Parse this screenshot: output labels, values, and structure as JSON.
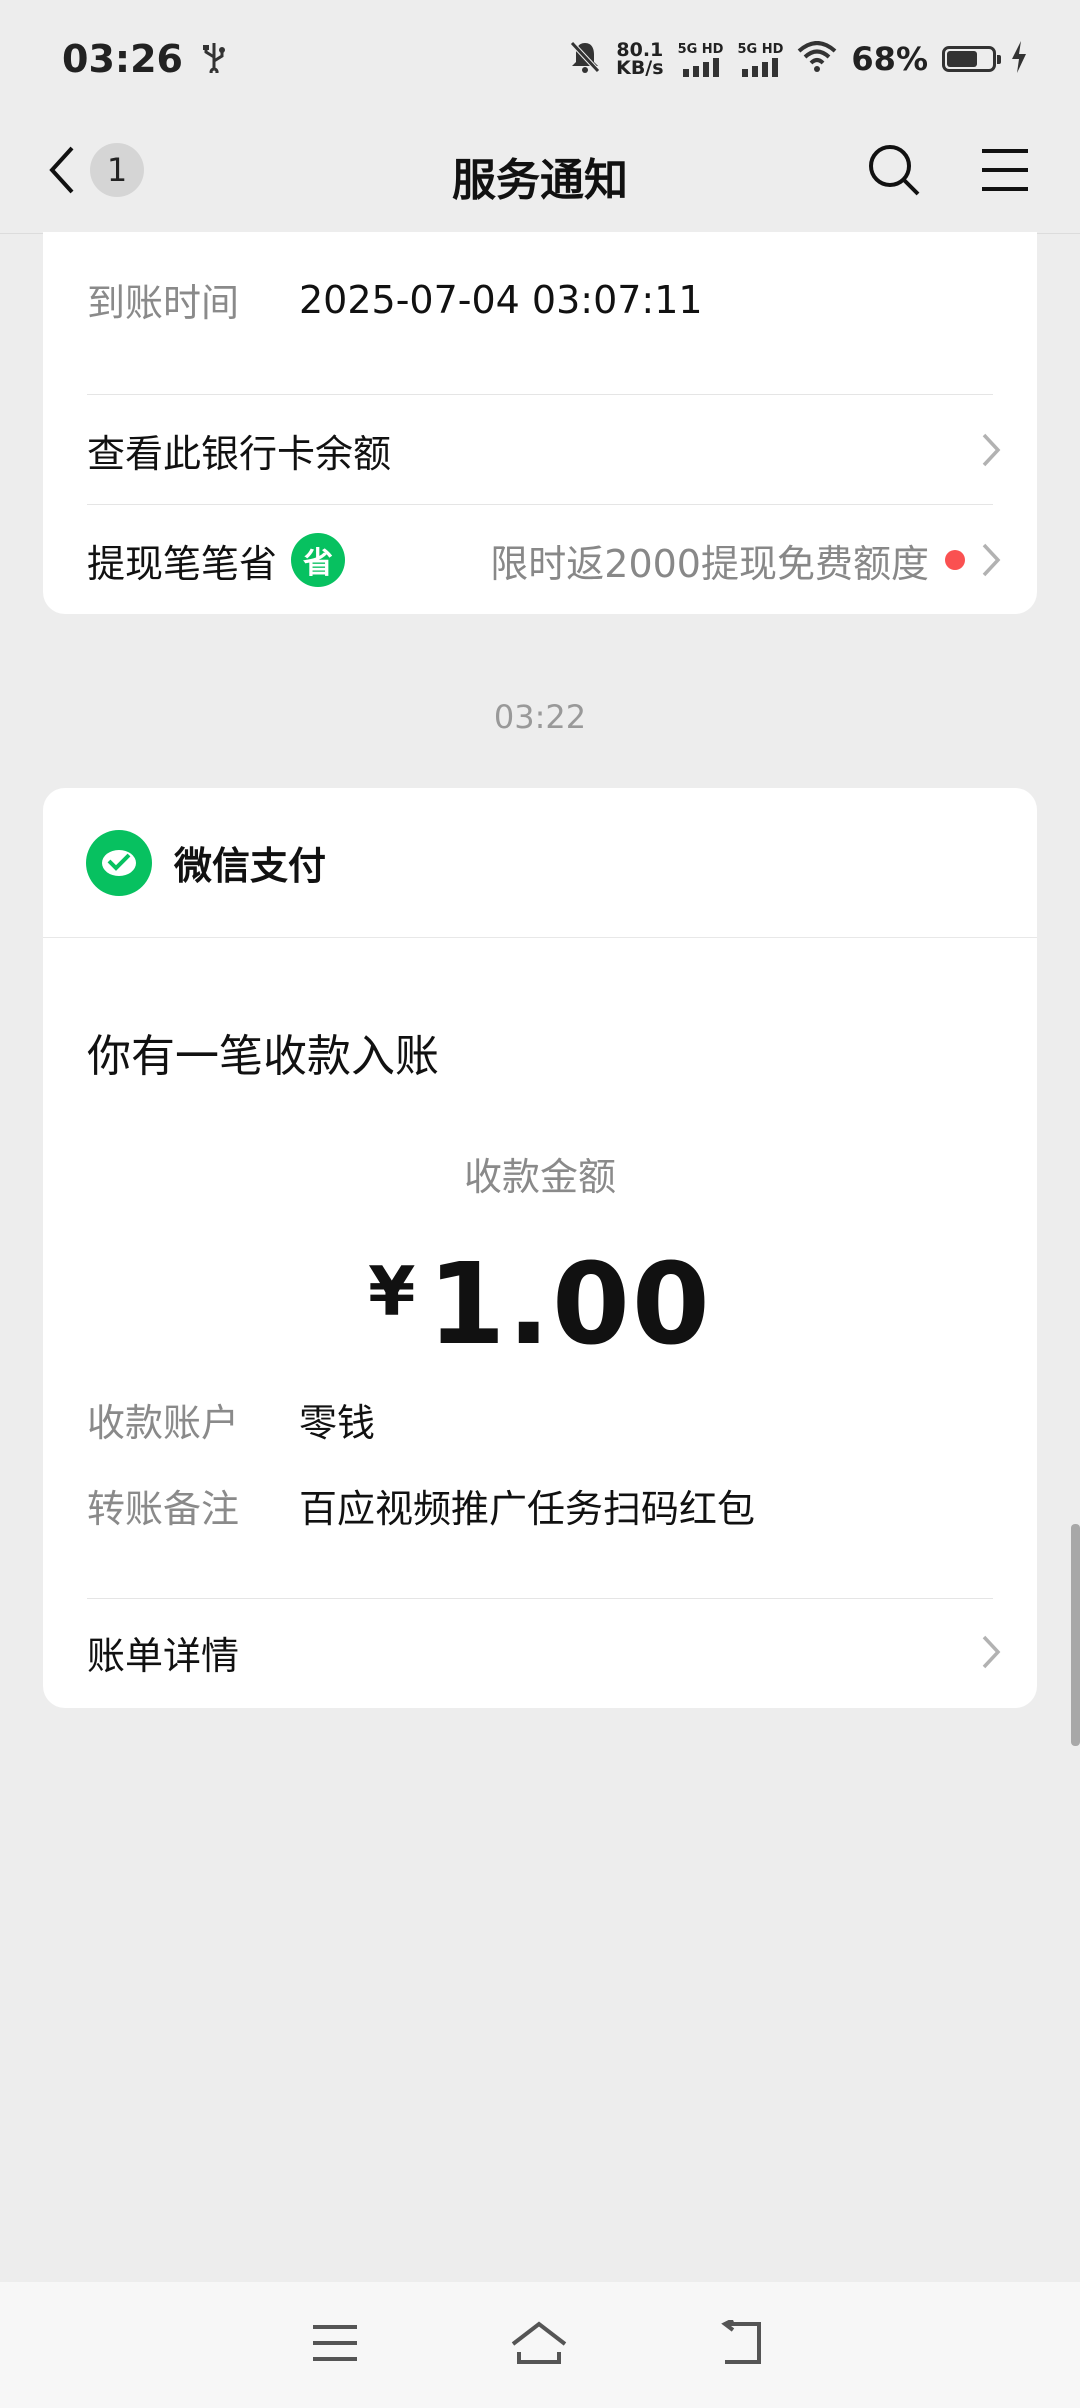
{
  "status": {
    "time": "03:26",
    "net_speed_value": "80.1",
    "net_speed_unit": "KB/s",
    "sim1_label": "5G HD",
    "sim2_label": "5G HD",
    "battery_pct": "68%",
    "battery_level": 0.68
  },
  "nav": {
    "unread_count": "1",
    "title": "服务通知"
  },
  "prev_card": {
    "arrival_label": "到账时间",
    "arrival_value": "2025-07-04 03:07:11",
    "check_balance": "查看此银行卡余额",
    "withdraw_label": "提现笔笔省",
    "withdraw_badge": "省",
    "withdraw_promo": "限时返2000提现免费额度"
  },
  "timestamp": "03:22",
  "pay_card": {
    "brand": "微信支付",
    "headline": "你有一笔收款入账",
    "amount_label": "收款金额",
    "currency": "¥",
    "amount": "1.00",
    "account_label": "收款账户",
    "account_value": "零钱",
    "remark_label": "转账备注",
    "remark_value": "百应视频推广任务扫码红包",
    "bill_detail": "账单详情"
  },
  "colors": {
    "wechat_green": "#07c160",
    "dot_red": "#fa5151",
    "background": "#ededed"
  }
}
